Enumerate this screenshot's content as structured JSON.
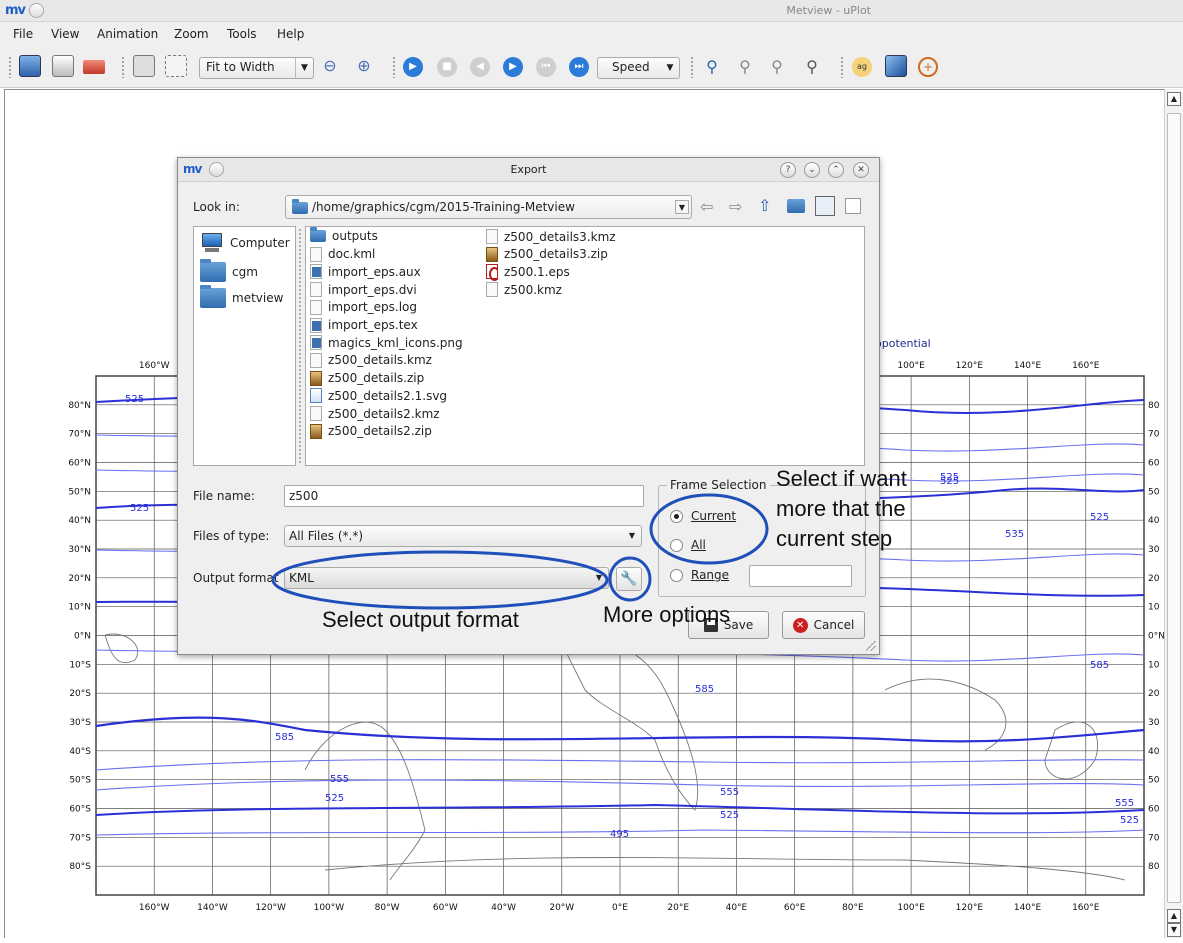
{
  "window": {
    "title": "Metview - uPlot",
    "logo": "mv"
  },
  "menu": [
    {
      "label": "File"
    },
    {
      "label": "View"
    },
    {
      "label": "Animation"
    },
    {
      "label": "Zoom"
    },
    {
      "label": "Tools"
    },
    {
      "label": "Help"
    }
  ],
  "toolbar": {
    "zoom_mode": "Fit to Width",
    "speed_label": "Speed"
  },
  "map": {
    "title_fragment": "opotential",
    "lon_labels": [
      "160°W",
      "140°W",
      "120°W",
      "100°W",
      "80°W",
      "60°W",
      "40°W",
      "20°W",
      "0°E",
      "20°E",
      "40°E",
      "60°E",
      "80°E",
      "100°E",
      "120°E",
      "140°E",
      "160°E"
    ],
    "lat_labels": [
      "80°N",
      "70°N",
      "60°N",
      "50°N",
      "40°N",
      "30°N",
      "20°N",
      "10°N",
      "0°N",
      "10°S",
      "20°S",
      "30°S",
      "40°S",
      "50°S",
      "60°S",
      "70°S",
      "80°S"
    ],
    "right_lat_labels": [
      "80",
      "70",
      "60",
      "50",
      "40",
      "30",
      "20",
      "10",
      "0°N",
      "10",
      "20",
      "30",
      "40",
      "50",
      "60",
      "70",
      "80"
    ],
    "contour_labels": [
      "525",
      "525",
      "525",
      "525",
      "585",
      "585",
      "585",
      "585",
      "555",
      "525",
      "555",
      "525",
      "495",
      "555",
      "525",
      "535",
      "525"
    ]
  },
  "dialog": {
    "title": "Export",
    "logo": "mv",
    "look_in_label": "Look in:",
    "path": "/home/graphics/cgm/2015-Training-Metview",
    "places": [
      {
        "label": "Computer",
        "icon": "computer-icon"
      },
      {
        "label": "cgm",
        "icon": "folder-icon"
      },
      {
        "label": "metview",
        "icon": "folder-icon"
      }
    ],
    "files_col1": [
      {
        "name": "outputs",
        "icon": "folder-icon"
      },
      {
        "name": "doc.kml",
        "icon": "file-icon"
      },
      {
        "name": "import_eps.aux",
        "icon": "aux-file-icon"
      },
      {
        "name": "import_eps.dvi",
        "icon": "file-icon"
      },
      {
        "name": "import_eps.log",
        "icon": "file-icon"
      },
      {
        "name": "import_eps.tex",
        "icon": "tex-file-icon"
      },
      {
        "name": "magics_kml_icons.png",
        "icon": "image-file-icon"
      },
      {
        "name": "z500_details.kmz",
        "icon": "file-icon"
      },
      {
        "name": "z500_details.zip",
        "icon": "zip-file-icon"
      },
      {
        "name": "z500_details2.1.svg",
        "icon": "svg-file-icon"
      },
      {
        "name": "z500_details2.kmz",
        "icon": "file-icon"
      },
      {
        "name": "z500_details2.zip",
        "icon": "zip-file-icon"
      }
    ],
    "files_col2": [
      {
        "name": "z500_details3.kmz",
        "icon": "file-icon"
      },
      {
        "name": "z500_details3.zip",
        "icon": "zip-file-icon"
      },
      {
        "name": "z500.1.eps",
        "icon": "eps-file-icon"
      },
      {
        "name": "z500.kmz",
        "icon": "file-icon"
      }
    ],
    "file_name_label": "File name:",
    "file_name_value": "z500",
    "files_of_type_label": "Files of type:",
    "files_of_type_value": "All Files (*.*)",
    "output_format_label": "Output format",
    "output_format_value": "KML",
    "frame_selection_label": "Frame Selection",
    "radio_current": "Current",
    "radio_all": "All",
    "radio_range": "Range",
    "range_value": "",
    "save_label": "Save",
    "cancel_label": "Cancel"
  },
  "annotations": {
    "select_frames": [
      "Select if want",
      "more that the",
      "current step"
    ],
    "select_output": "Select output format",
    "more_options": "More options",
    "highlight_color": "#1f4fb8"
  }
}
